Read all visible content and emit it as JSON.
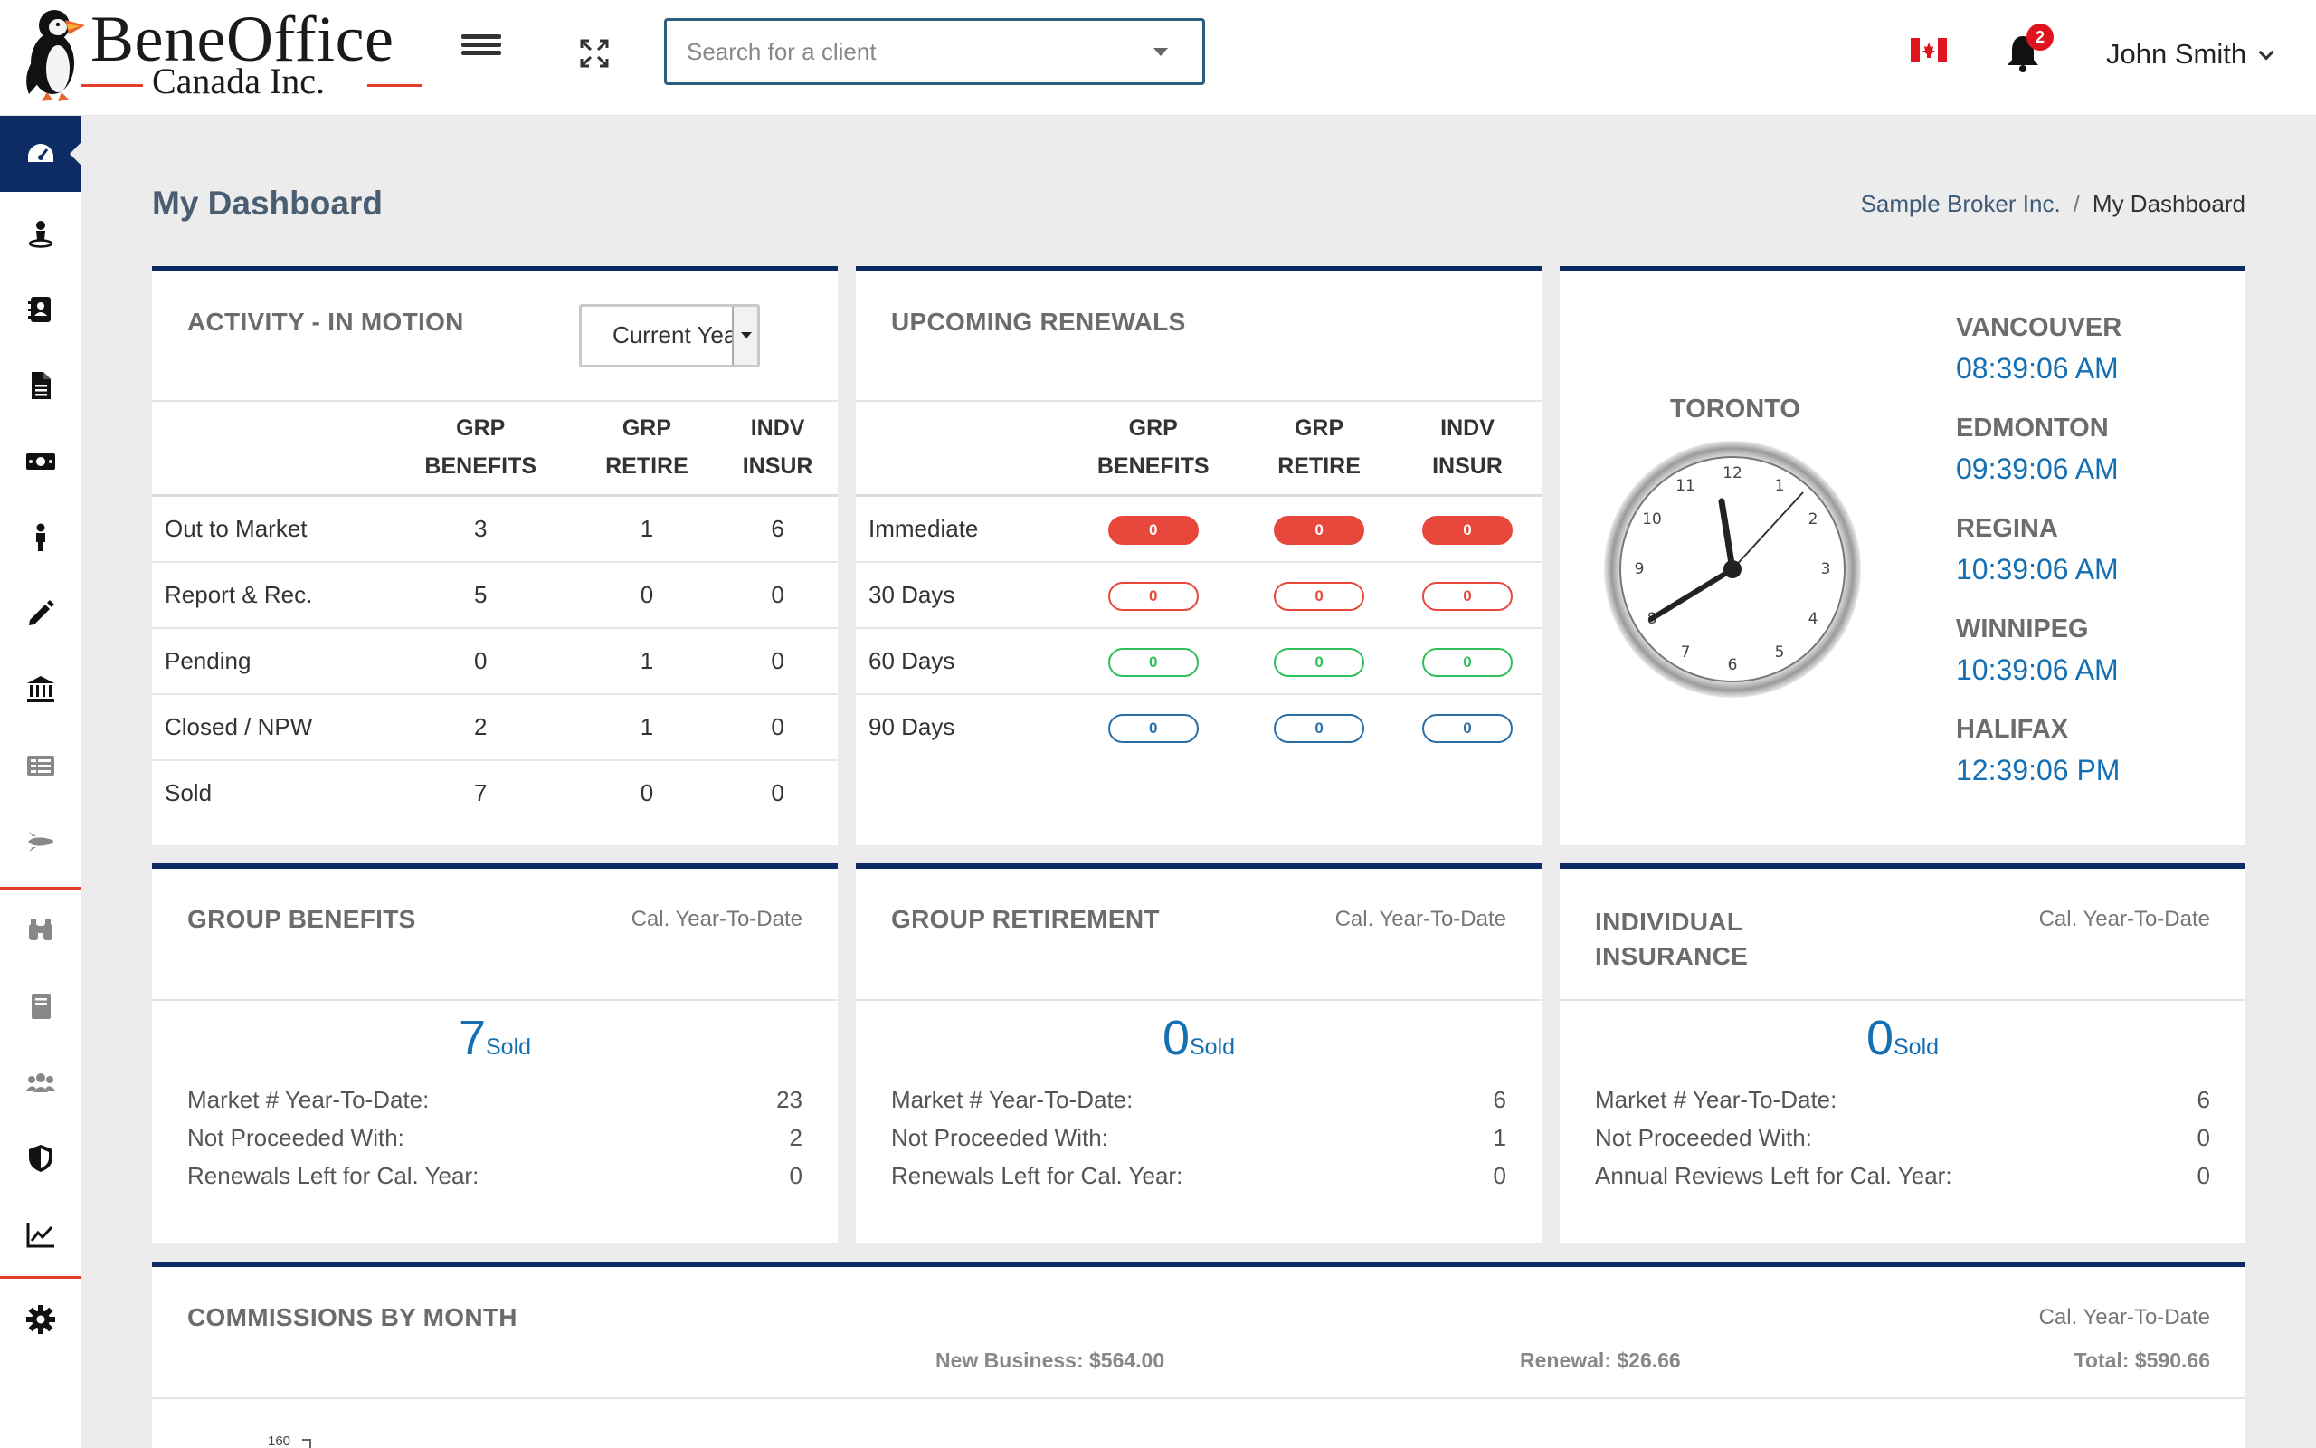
{
  "header": {
    "logo_title": "BeneOffice",
    "logo_sub": "Canada Inc.",
    "search_placeholder": "Search for a client",
    "notification_count": "2",
    "user_name": "John Smith"
  },
  "sidebar": {
    "items": [
      {
        "icon": "dashboard-icon",
        "active": true
      },
      {
        "icon": "person-pin-icon"
      },
      {
        "icon": "contact-book-icon"
      },
      {
        "icon": "document-icon"
      },
      {
        "icon": "money-icon"
      },
      {
        "icon": "person-icon"
      },
      {
        "icon": "pencil-icon"
      },
      {
        "icon": "bank-icon"
      },
      {
        "icon": "list-icon"
      },
      {
        "icon": "rocket-icon"
      },
      {
        "icon": "binoculars-icon"
      },
      {
        "icon": "book-icon"
      },
      {
        "icon": "users-icon"
      },
      {
        "icon": "shield-icon"
      },
      {
        "icon": "chart-icon"
      },
      {
        "icon": "gear-icon"
      }
    ],
    "accent": "#0d2c66",
    "divider_color": "#e23d2b"
  },
  "page": {
    "title": "My Dashboard",
    "breadcrumb": [
      "Sample Broker Inc.",
      "My Dashboard"
    ],
    "breadcrumb_sep": "/"
  },
  "activity": {
    "title": "ACTIVITY - IN MOTION",
    "period": "Current Year",
    "columns": [
      [
        "GRP",
        "BENEFITS"
      ],
      [
        "GRP",
        "RETIRE"
      ],
      [
        "INDV",
        "INSUR"
      ]
    ],
    "rows": [
      {
        "label": "Out to Market",
        "values": [
          "3",
          "1",
          "6"
        ]
      },
      {
        "label": "Report & Rec.",
        "values": [
          "5",
          "0",
          "0"
        ]
      },
      {
        "label": "Pending",
        "values": [
          "0",
          "1",
          "0"
        ]
      },
      {
        "label": "Closed / NPW",
        "values": [
          "2",
          "1",
          "0"
        ]
      },
      {
        "label": "Sold",
        "values": [
          "7",
          "0",
          "0"
        ]
      }
    ]
  },
  "renewals": {
    "title": "UPCOMING RENEWALS",
    "columns": [
      [
        "GRP",
        "BENEFITS"
      ],
      [
        "GRP",
        "RETIRE"
      ],
      [
        "INDV",
        "INSUR"
      ]
    ],
    "rows": [
      {
        "label": "Immediate",
        "values": [
          "0",
          "0",
          "0"
        ],
        "style": "imm"
      },
      {
        "label": "30 Days",
        "values": [
          "0",
          "0",
          "0"
        ],
        "style": "d30"
      },
      {
        "label": "60 Days",
        "values": [
          "0",
          "0",
          "0"
        ],
        "style": "d60"
      },
      {
        "label": "90 Days",
        "values": [
          "0",
          "0",
          "0"
        ],
        "style": "d90"
      }
    ]
  },
  "clocks": {
    "main_city": "TORONTO",
    "cities": [
      {
        "name": "VANCOUVER",
        "time": "08:39:06 AM"
      },
      {
        "name": "EDMONTON",
        "time": "09:39:06 AM"
      },
      {
        "name": "REGINA",
        "time": "10:39:06 AM"
      },
      {
        "name": "WINNIPEG",
        "time": "10:39:06 AM"
      },
      {
        "name": "HALIFAX",
        "time": "12:39:06 PM"
      }
    ]
  },
  "summaries": [
    {
      "title": "GROUP BENEFITS",
      "meta": "Cal. Year-To-Date",
      "sold": "7",
      "sold_label": "Sold",
      "stats": [
        {
          "label": "Market # Year-To-Date:",
          "value": "23"
        },
        {
          "label": "Not Proceeded With:",
          "value": "2"
        },
        {
          "label": "Renewals Left for Cal. Year:",
          "value": "0"
        }
      ]
    },
    {
      "title": "GROUP RETIREMENT",
      "meta": "Cal. Year-To-Date",
      "sold": "0",
      "sold_label": "Sold",
      "stats": [
        {
          "label": "Market # Year-To-Date:",
          "value": "6"
        },
        {
          "label": "Not Proceeded With:",
          "value": "1"
        },
        {
          "label": "Renewals Left for Cal. Year:",
          "value": "0"
        }
      ]
    },
    {
      "title": "INDIVIDUAL INSURANCE",
      "meta": "Cal. Year-To-Date",
      "sold": "0",
      "sold_label": "Sold",
      "stats": [
        {
          "label": "Market # Year-To-Date:",
          "value": "6"
        },
        {
          "label": "Not Proceeded With:",
          "value": "0"
        },
        {
          "label": "Annual Reviews Left for Cal. Year:",
          "value": "0"
        }
      ]
    }
  ],
  "commissions": {
    "title": "COMMISSIONS BY MONTH",
    "meta": "Cal. Year-To-Date",
    "new_business": "New Business: $564.00",
    "renewal": "Renewal: $26.66",
    "total": "Total: $590.66",
    "axis_top": "160"
  }
}
